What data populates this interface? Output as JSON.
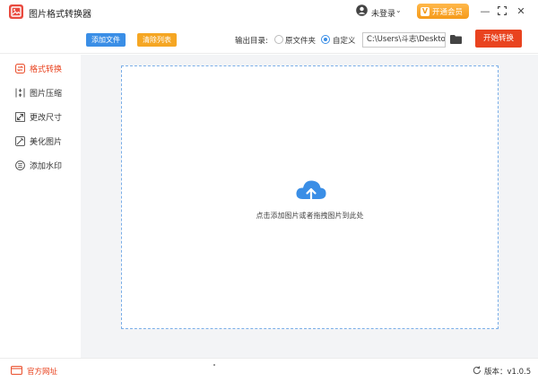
{
  "app": {
    "title": "图片格式转换器"
  },
  "titlebar": {
    "login_text": "未登录",
    "vip_label": "开通会员",
    "vip_icon": "V"
  },
  "toolbar": {
    "add_file": "添加文件",
    "clear_list": "清除列表",
    "output_label": "输出目录:",
    "option_original": "原文件夹",
    "option_custom": "自定义",
    "selected_option": "自定义",
    "output_path": "C:\\Users\\斗志\\Desktop",
    "start_button": "开始转换"
  },
  "sidebar": {
    "items": [
      {
        "label": "格式转换",
        "icon": "format-convert-icon",
        "active": true
      },
      {
        "label": "图片压缩",
        "icon": "compress-icon",
        "active": false
      },
      {
        "label": "更改尺寸",
        "icon": "resize-icon",
        "active": false
      },
      {
        "label": "美化图片",
        "icon": "beautify-icon",
        "active": false
      },
      {
        "label": "添加水印",
        "icon": "watermark-icon",
        "active": false
      }
    ]
  },
  "dropzone": {
    "hint": "点击添加图片或者拖拽图片到此处"
  },
  "footer": {
    "site_link": "官方网址",
    "version": "版本：v1.0.5"
  },
  "colors": {
    "accent_red": "#e9431f",
    "accent_blue": "#3a8ee6",
    "accent_orange": "#f5a623"
  }
}
